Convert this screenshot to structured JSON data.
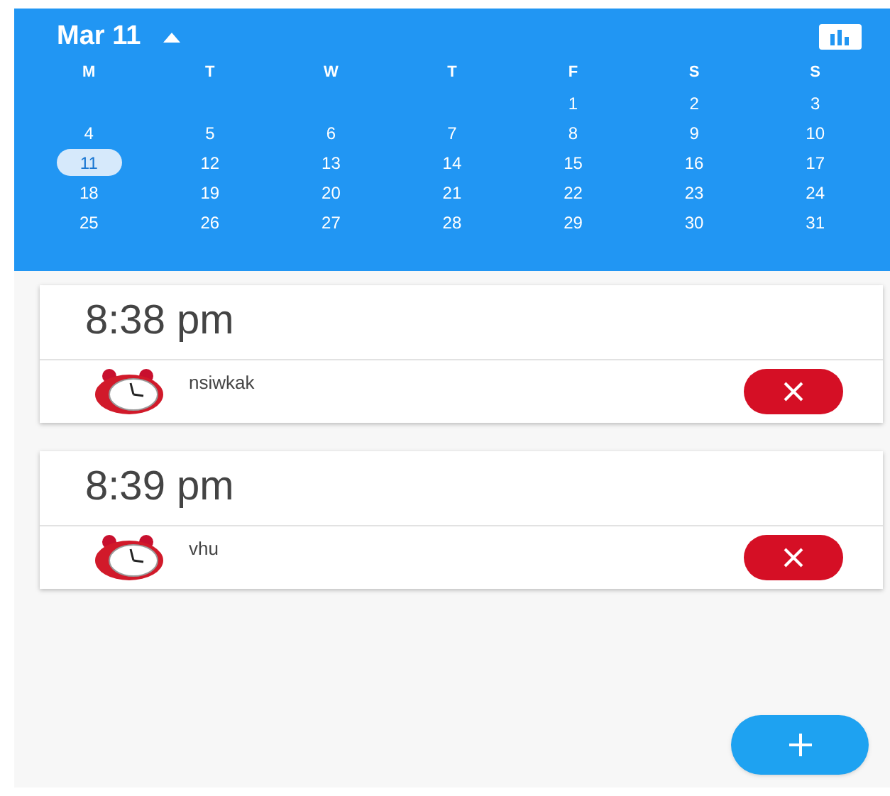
{
  "header": {
    "month_label": "Mar 11",
    "expanded": true
  },
  "weekdays": [
    "M",
    "T",
    "W",
    "T",
    "F",
    "S",
    "S"
  ],
  "weeks": [
    {
      "kind": "trailing",
      "days": [
        {
          "label": "1",
          "selected": false
        },
        {
          "label": "2",
          "selected": false
        },
        {
          "label": "3",
          "selected": false
        }
      ]
    },
    {
      "kind": "full",
      "days": [
        {
          "label": "4",
          "selected": false
        },
        {
          "label": "5",
          "selected": false
        },
        {
          "label": "6",
          "selected": false
        },
        {
          "label": "7",
          "selected": false
        },
        {
          "label": "8",
          "selected": false
        },
        {
          "label": "9",
          "selected": false
        },
        {
          "label": "10",
          "selected": false
        }
      ]
    },
    {
      "kind": "full",
      "days": [
        {
          "label": "11",
          "selected": true
        },
        {
          "label": "12",
          "selected": false
        },
        {
          "label": "13",
          "selected": false
        },
        {
          "label": "14",
          "selected": false
        },
        {
          "label": "15",
          "selected": false
        },
        {
          "label": "16",
          "selected": false
        },
        {
          "label": "17",
          "selected": false
        }
      ]
    },
    {
      "kind": "full",
      "days": [
        {
          "label": "18",
          "selected": false
        },
        {
          "label": "19",
          "selected": false
        },
        {
          "label": "20",
          "selected": false
        },
        {
          "label": "21",
          "selected": false
        },
        {
          "label": "22",
          "selected": false
        },
        {
          "label": "23",
          "selected": false
        },
        {
          "label": "24",
          "selected": false
        }
      ]
    },
    {
      "kind": "full",
      "days": [
        {
          "label": "25",
          "selected": false
        },
        {
          "label": "26",
          "selected": false
        },
        {
          "label": "27",
          "selected": false
        },
        {
          "label": "28",
          "selected": false
        },
        {
          "label": "29",
          "selected": false
        },
        {
          "label": "30",
          "selected": false
        },
        {
          "label": "31",
          "selected": false
        }
      ]
    }
  ],
  "alarms": [
    {
      "time": "8:38 pm",
      "name": "nsiwkak"
    },
    {
      "time": "8:39 pm",
      "name": "vhu"
    }
  ]
}
